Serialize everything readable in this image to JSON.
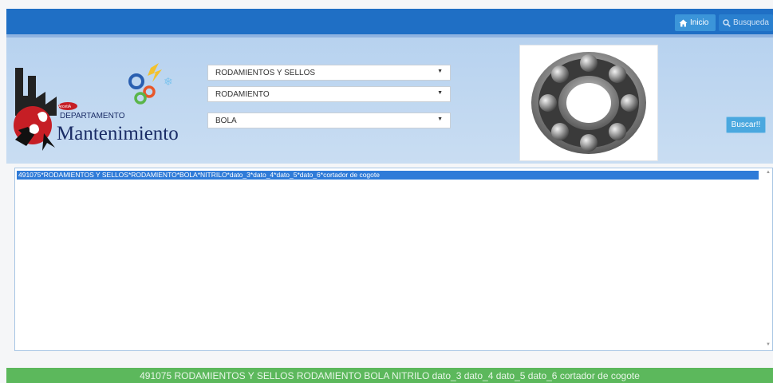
{
  "nav": {
    "inicio_label": "Inicio",
    "busqueda_label": "Busqueda"
  },
  "logo": {
    "badge": "ArcetiA",
    "line1": "DEPARTAMENTO",
    "line2": "Mantenimiento"
  },
  "filters": {
    "category": "RODAMIENTOS Y SELLOS",
    "subcategory": "RODAMIENTO",
    "type": "BOLA"
  },
  "search_button_label": "Buscar!!",
  "results": [
    "491075*RODAMIENTOS Y SELLOS*RODAMIENTO*BOLA*NITRILO*dato_3*dato_4*dato_5*dato_6*cortador de cogote"
  ],
  "footer_text": "491075 RODAMIENTOS Y SELLOS RODAMIENTO BOLA NITRILO dato_3 dato_4 dato_5 dato_6 cortador de cogote",
  "colors": {
    "topbar": "#1f6fc5",
    "header": "#c3d9f1",
    "selected_row": "#2f7bd8",
    "footer": "#5cb85c"
  }
}
